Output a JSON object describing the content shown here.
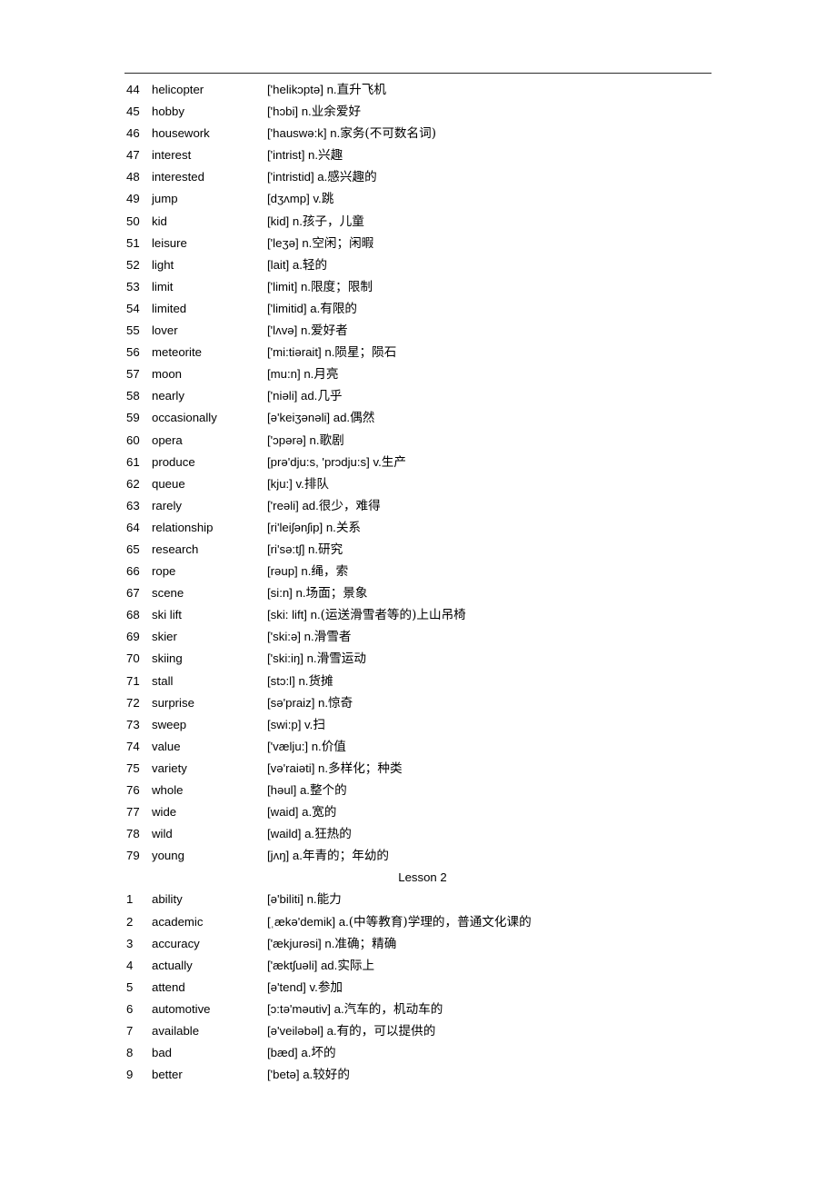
{
  "document": {
    "type": "vocabulary-list",
    "has_top_rule": true
  },
  "blocks": [
    {
      "kind": "entries",
      "entries": [
        {
          "num": "44",
          "word": "helicopter",
          "phonetic": "['helikɔptə]",
          "pos": "n.",
          "gloss": "直升飞机"
        },
        {
          "num": "45",
          "word": "hobby",
          "phonetic": "['hɔbi]",
          "pos": "n.",
          "gloss": "业余爱好"
        },
        {
          "num": "46",
          "word": "housework",
          "phonetic": "['hauswə:k]",
          "pos": "n.",
          "gloss": "家务(不可数名词)"
        },
        {
          "num": "47",
          "word": "interest",
          "phonetic": "['intrist]",
          "pos": "n.",
          "gloss": "兴趣"
        },
        {
          "num": "48",
          "word": "interested",
          "phonetic": "['intristid]",
          "pos": "a.",
          "gloss": "感兴趣的"
        },
        {
          "num": "49",
          "word": "jump",
          "phonetic": "[dʒʌmp]",
          "pos": "v.",
          "gloss": "跳"
        },
        {
          "num": "50",
          "word": "kid",
          "phonetic": "[kid]",
          "pos": "n.",
          "gloss": "孩子，儿童"
        },
        {
          "num": "51",
          "word": "leisure",
          "phonetic": "['leʒə]",
          "pos": "n.",
          "gloss": "空闲；闲暇"
        },
        {
          "num": "52",
          "word": "light",
          "phonetic": "[lait]",
          "pos": "a.",
          "gloss": "轻的"
        },
        {
          "num": "53",
          "word": "limit",
          "phonetic": "['limit]",
          "pos": "n.",
          "gloss": "限度；限制"
        },
        {
          "num": "54",
          "word": "limited",
          "phonetic": "['limitid]",
          "pos": "a.",
          "gloss": "有限的"
        },
        {
          "num": "55",
          "word": "lover",
          "phonetic": "['lʌvə]",
          "pos": "n.",
          "gloss": "爱好者"
        },
        {
          "num": "56",
          "word": "meteorite",
          "phonetic": "['mi:tiərait]",
          "pos": "n.",
          "gloss": "陨星；陨石"
        },
        {
          "num": "57",
          "word": "moon",
          "phonetic": "[mu:n]",
          "pos": "n.",
          "gloss": "月亮"
        },
        {
          "num": "58",
          "word": "nearly",
          "phonetic": "['niəli]",
          "pos": "ad.",
          "gloss": "几乎"
        },
        {
          "num": "59",
          "word": "occasionally",
          "phonetic": "[ə'keiʒənəli]",
          "pos": "ad.",
          "gloss": "偶然"
        },
        {
          "num": "60",
          "word": "opera",
          "phonetic": "['ɔpərə]",
          "pos": "n.",
          "gloss": "歌剧"
        },
        {
          "num": "61",
          "word": "produce",
          "phonetic": "[prə'dju:s, 'prɔdju:s]",
          "pos": "v.",
          "gloss": "生产"
        },
        {
          "num": "62",
          "word": "queue",
          "phonetic": "[kju:]",
          "pos": "v.",
          "gloss": "排队"
        },
        {
          "num": "63",
          "word": "rarely",
          "phonetic": "['reəli]",
          "pos": "ad.",
          "gloss": "很少，难得"
        },
        {
          "num": "64",
          "word": "relationship",
          "phonetic": "[ri'leiʃənʃip]",
          "pos": "n.",
          "gloss": "关系"
        },
        {
          "num": "65",
          "word": "research",
          "phonetic": "[ri'sə:tʃ]",
          "pos": "n.",
          "gloss": "研究"
        },
        {
          "num": "66",
          "word": "rope",
          "phonetic": "[rəup]",
          "pos": "n.",
          "gloss": "绳，索"
        },
        {
          "num": "67",
          "word": "scene",
          "phonetic": "[si:n]",
          "pos": "n.",
          "gloss": "场面；景象"
        },
        {
          "num": "68",
          "word": "ski lift",
          "phonetic": "[ski: lift]",
          "pos": "n.",
          "gloss": "(运送滑雪者等的)上山吊椅"
        },
        {
          "num": "69",
          "word": "skier",
          "phonetic": "['ski:ə]",
          "pos": "n.",
          "gloss": "滑雪者"
        },
        {
          "num": "70",
          "word": "skiing",
          "phonetic": "['ski:iŋ]",
          "pos": "n.",
          "gloss": "滑雪运动"
        },
        {
          "num": "71",
          "word": "stall",
          "phonetic": "[stɔ:l]",
          "pos": "n.",
          "gloss": "货摊"
        },
        {
          "num": "72",
          "word": "surprise",
          "phonetic": "[sə'praiz]",
          "pos": "n.",
          "gloss": "惊奇"
        },
        {
          "num": "73",
          "word": "sweep",
          "phonetic": "[swi:p]",
          "pos": "v.",
          "gloss": "扫"
        },
        {
          "num": "74",
          "word": "value",
          "phonetic": "['vælju:]",
          "pos": "n.",
          "gloss": "价值"
        },
        {
          "num": "75",
          "word": "variety",
          "phonetic": "[və'raiəti]",
          "pos": "n.",
          "gloss": "多样化；种类"
        },
        {
          "num": "76",
          "word": "whole",
          "phonetic": "[həul]",
          "pos": "a.",
          "gloss": "整个的"
        },
        {
          "num": "77",
          "word": "wide",
          "phonetic": "[waid]",
          "pos": "a.",
          "gloss": "宽的"
        },
        {
          "num": "78",
          "word": "wild",
          "phonetic": "[waild]",
          "pos": "a.",
          "gloss": "狂热的"
        },
        {
          "num": "79",
          "word": "young",
          "phonetic": "[jʌŋ]",
          "pos": "a.",
          "gloss": "年青的；年幼的"
        }
      ]
    },
    {
      "kind": "heading",
      "title": "Lesson 2"
    },
    {
      "kind": "entries",
      "entries": [
        {
          "num": "1",
          "word": "ability",
          "phonetic": "[ə'biliti]",
          "pos": "n.",
          "gloss": "能力"
        },
        {
          "num": "2",
          "word": "academic",
          "phonetic": "[ˌækə'demik]",
          "pos": "a.",
          "gloss": "(中等教育)学理的，普通文化课的"
        },
        {
          "num": "3",
          "word": "accuracy",
          "phonetic": "['ækjurəsi]",
          "pos": "n.",
          "gloss": "准确；精确"
        },
        {
          "num": "4",
          "word": "actually",
          "phonetic": "['æktʃuəli]",
          "pos": "ad.",
          "gloss": "实际上"
        },
        {
          "num": "5",
          "word": "attend",
          "phonetic": "[ə'tend]",
          "pos": "v.",
          "gloss": "参加"
        },
        {
          "num": "6",
          "word": "automotive",
          "phonetic": "[ɔ:tə'məutiv]",
          "pos": "a.",
          "gloss": "汽车的，机动车的"
        },
        {
          "num": "7",
          "word": "available",
          "phonetic": "[ə'veiləbəl]",
          "pos": "a.",
          "gloss": "有的，可以提供的"
        },
        {
          "num": "8",
          "word": "bad",
          "phonetic": "[bæd]",
          "pos": "a.",
          "gloss": "坏的"
        },
        {
          "num": "9",
          "word": "better",
          "phonetic": "['betə]",
          "pos": "a.",
          "gloss": "较好的"
        }
      ]
    }
  ]
}
